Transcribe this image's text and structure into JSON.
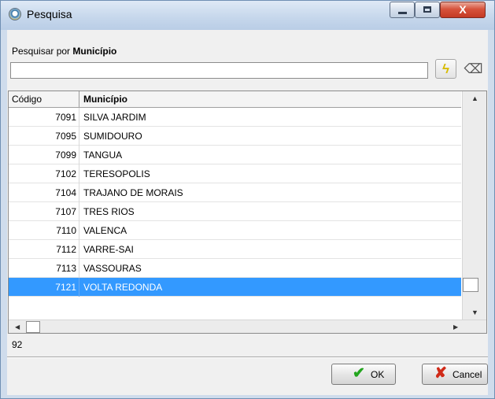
{
  "window": {
    "title": "Pesquisa",
    "minimize_glyph": "",
    "maximize_glyph": "",
    "close_glyph": "X"
  },
  "search": {
    "label_prefix": "Pesquisar por",
    "label_field": "Município",
    "value": "",
    "execute_icon": "lightning-icon",
    "clear_icon": "eraser-icon"
  },
  "grid": {
    "columns": [
      "Código",
      "Município"
    ],
    "rows": [
      {
        "code": "7091",
        "name": "SILVA JARDIM",
        "selected": false
      },
      {
        "code": "7095",
        "name": "SUMIDOURO",
        "selected": false
      },
      {
        "code": "7099",
        "name": "TANGUA",
        "selected": false
      },
      {
        "code": "7102",
        "name": "TERESOPOLIS",
        "selected": false
      },
      {
        "code": "7104",
        "name": "TRAJANO DE MORAIS",
        "selected": false
      },
      {
        "code": "7107",
        "name": "TRES RIOS",
        "selected": false
      },
      {
        "code": "7110",
        "name": "VALENCA",
        "selected": false
      },
      {
        "code": "7112",
        "name": "VARRE-SAI",
        "selected": false
      },
      {
        "code": "7113",
        "name": "VASSOURAS",
        "selected": false
      },
      {
        "code": "7121",
        "name": "VOLTA REDONDA",
        "selected": true
      }
    ],
    "selection_color": "#3399ff"
  },
  "status": {
    "count": "92"
  },
  "buttons": {
    "ok_label": "OK",
    "cancel_label": "Cancel",
    "ok_icon": "checkmark-icon",
    "cancel_icon": "x-icon"
  }
}
